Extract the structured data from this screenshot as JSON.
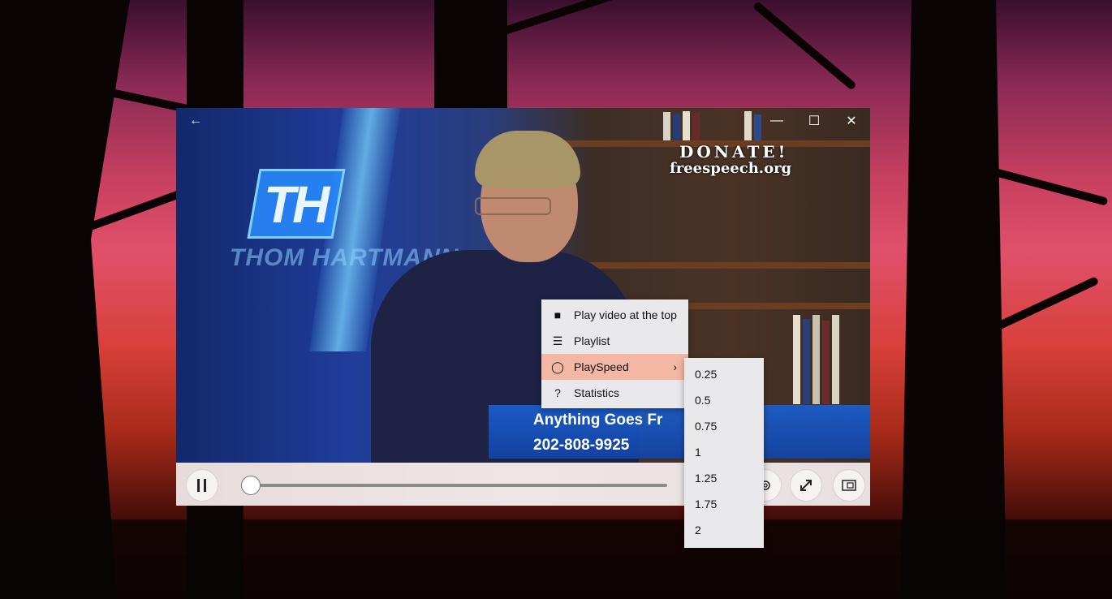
{
  "window": {
    "back_icon": "←",
    "minimize_icon": "—",
    "maximize_icon": "☐",
    "close_icon": "✕"
  },
  "video": {
    "logo_letters": "TH",
    "logo_name": "THOM HARTMANN",
    "donate": "DONATE!",
    "site": "freespeech.org",
    "banner_line1": "Anything Goes Fr",
    "banner_line2": "202-808-9925"
  },
  "controls": {
    "play_pause_icon": "pause-icon",
    "progress": 0.0,
    "settings_icon": "gear-icon",
    "fullscreen_icon": "expand-icon",
    "compact_icon": "compact-overlay-icon"
  },
  "context_menu": {
    "items": [
      {
        "label": "Play video at the top",
        "icon": "■"
      },
      {
        "label": "Playlist",
        "icon": "☰"
      },
      {
        "label": "PlaySpeed",
        "icon": "◯",
        "submenu_indicator": "›"
      },
      {
        "label": "Statistics",
        "icon": "?"
      }
    ],
    "highlight_color": "#f3b7a4"
  },
  "speed_submenu": {
    "options": [
      "0.25",
      "0.5",
      "0.75",
      "1",
      "1.25",
      "1.75",
      "2"
    ]
  }
}
